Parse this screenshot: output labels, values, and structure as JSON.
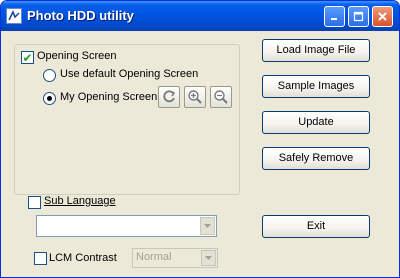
{
  "window": {
    "title": "Photo HDD utility"
  },
  "titlebar_buttons": {
    "minimize_icon": "minimize-icon",
    "maximize_icon": "maximize-icon",
    "close_icon": "close-icon"
  },
  "opening_screen": {
    "label": "Opening Screen",
    "checked": true,
    "options": [
      {
        "label": "Use default Opening Screen",
        "selected": false
      },
      {
        "label": "My Opening Screen",
        "selected": true
      }
    ],
    "tools": [
      "rotate-icon",
      "zoom-in-icon",
      "zoom-out-icon"
    ]
  },
  "sub_language": {
    "label": "Sub Language",
    "checked": false,
    "value": ""
  },
  "lcm_contrast": {
    "label": "LCM Contrast",
    "checked": false,
    "value": "Normal"
  },
  "buttons": {
    "load": "Load Image File",
    "sample": "Sample Images",
    "update": "Update",
    "safely_remove": "Safely Remove",
    "exit": "Exit"
  }
}
